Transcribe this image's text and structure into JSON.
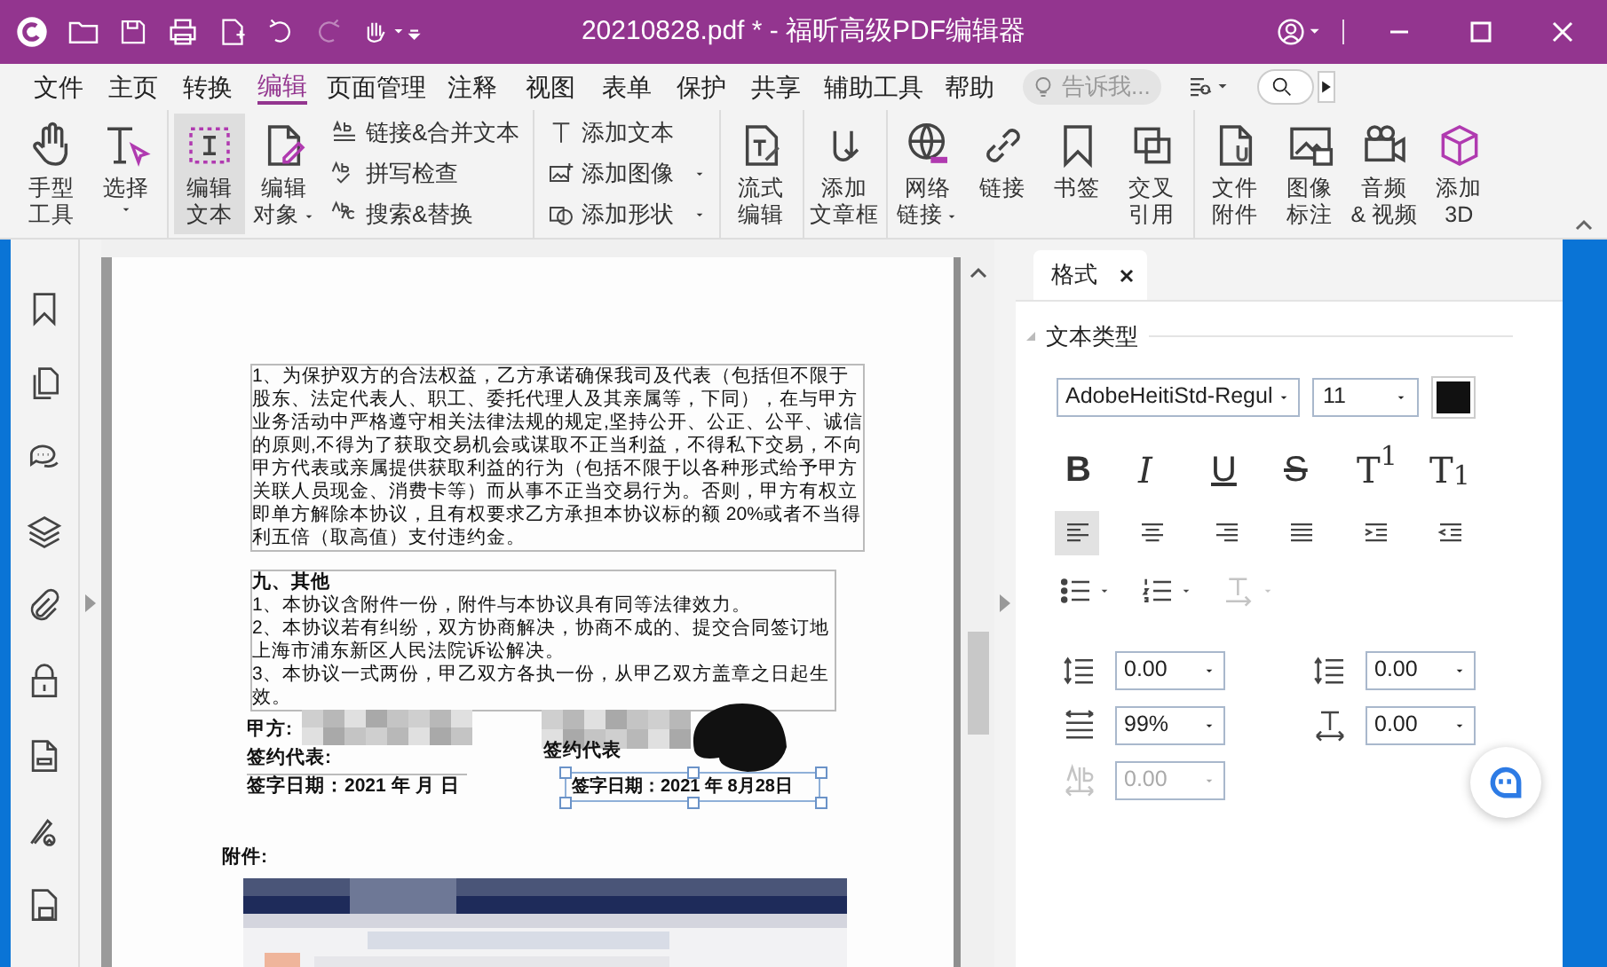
{
  "window": {
    "title": "20210828.pdf * - 福昕高级PDF编辑器"
  },
  "menu": [
    {
      "label": "文件",
      "selected": false
    },
    {
      "label": "主页",
      "selected": false
    },
    {
      "label": "转换",
      "selected": false
    },
    {
      "label": "编辑",
      "selected": true
    },
    {
      "label": "页面管理",
      "selected": false
    },
    {
      "label": "注释",
      "selected": false
    },
    {
      "label": "视图",
      "selected": false
    },
    {
      "label": "表单",
      "selected": false
    },
    {
      "label": "保护",
      "selected": false
    },
    {
      "label": "共享",
      "selected": false
    },
    {
      "label": "辅助工具",
      "selected": false
    },
    {
      "label": "帮助",
      "selected": false
    }
  ],
  "tell_me": {
    "placeholder": "告诉我..."
  },
  "ribbon": [
    {
      "items": [
        {
          "kind": "large",
          "lines": [
            "手型",
            "工具"
          ],
          "dropdown": false,
          "selected": false
        },
        {
          "kind": "large",
          "lines": [
            "选择"
          ],
          "dropdown": true,
          "selected": false
        }
      ]
    },
    {
      "items": [
        {
          "kind": "large",
          "lines": [
            "编辑",
            "文本"
          ],
          "dropdown": false,
          "selected": true
        },
        {
          "kind": "large",
          "lines": [
            "编辑",
            "对象"
          ],
          "dropdown": true,
          "selected": false
        },
        {
          "kind": "small",
          "lines": [
            "链接&合并文本"
          ],
          "dropdown": false,
          "selected": false
        },
        {
          "kind": "small",
          "lines": [
            "拼写检查"
          ],
          "dropdown": false,
          "selected": false
        },
        {
          "kind": "small",
          "lines": [
            "搜索&替换"
          ],
          "dropdown": false,
          "selected": false
        }
      ]
    },
    {
      "items": [
        {
          "kind": "small",
          "lines": [
            "添加文本"
          ],
          "dropdown": false,
          "selected": false
        },
        {
          "kind": "small",
          "lines": [
            "添加图像"
          ],
          "dropdown": true,
          "selected": false
        },
        {
          "kind": "small",
          "lines": [
            "添加形状"
          ],
          "dropdown": true,
          "selected": false
        }
      ]
    },
    {
      "items": [
        {
          "kind": "large",
          "lines": [
            "流式",
            "编辑"
          ],
          "dropdown": false,
          "selected": false
        }
      ]
    },
    {
      "items": [
        {
          "kind": "large",
          "lines": [
            "添加",
            "文章框"
          ],
          "dropdown": false,
          "selected": false
        }
      ]
    },
    {
      "items": [
        {
          "kind": "large",
          "lines": [
            "网络",
            "链接"
          ],
          "dropdown": true,
          "selected": false
        },
        {
          "kind": "large",
          "lines": [
            "链接"
          ],
          "dropdown": false,
          "selected": false
        },
        {
          "kind": "large",
          "lines": [
            "书签"
          ],
          "dropdown": false,
          "selected": false
        },
        {
          "kind": "large",
          "lines": [
            "交叉",
            "引用"
          ],
          "dropdown": false,
          "selected": false
        }
      ]
    },
    {
      "items": [
        {
          "kind": "large",
          "lines": [
            "文件",
            "附件"
          ],
          "dropdown": false,
          "selected": false
        },
        {
          "kind": "large",
          "lines": [
            "图像",
            "标注"
          ],
          "dropdown": false,
          "selected": false
        },
        {
          "kind": "large",
          "lines": [
            "音频",
            "& 视频"
          ],
          "dropdown": false,
          "selected": false
        },
        {
          "kind": "large",
          "lines": [
            "添加",
            "3D"
          ],
          "dropdown": false,
          "selected": false
        }
      ]
    }
  ],
  "document": {
    "clause": "1、为保护双方的合法权益，乙方承诺确保我司及代表（包括但不限于股东、法定代表人、职工、委托代理人及其亲属等，下同），在与甲方业务活动中严格遵守相关法律法规的规定,坚持公开、公正、公平、诚信的原则,不得为了获取交易机会或谋取不正当利益，不得私下交易，不向甲方代表或亲属提供获取利益的行为（包括不限于以各种形式给予甲方关联人员现金、消费卡等）而从事不正当交易行为。否则，甲方有权立即单方解除本协议，且有权要求乙方承担本协议标的额 20%或者不当得利五倍（取高值）支付违约金。",
    "section_title": "九、其他",
    "section_lines": [
      "1、本协议含附件一份，附件与本协议具有同等法律效力。",
      "2、本协议若有纠纷，双方协商解决，协商不成的、提交合同签订地上海市浦东新区人民法院诉讼解决。",
      "3、本协议一式两份，甲乙双方各执一份，从甲乙双方盖章之日起生效。"
    ],
    "party_a": "甲方:",
    "signer_left": "签约代表:",
    "date_left": "签字日期：2021 年    月    日",
    "signer_right": "签约代表",
    "date_right": "签字日期：2021 年 8月28日",
    "attachment_label": "附件:"
  },
  "format_panel": {
    "tab": {
      "label": "格式",
      "selected": true
    },
    "section": "文本类型",
    "font": "AdobeHeitiStd-Regul",
    "size": "11",
    "color": "#111111",
    "styles": [
      {
        "glyph": "B",
        "kind": "bold"
      },
      {
        "glyph": "I",
        "kind": "italic"
      },
      {
        "glyph": "U",
        "kind": "underline"
      },
      {
        "glyph": "S",
        "kind": "strike"
      },
      {
        "glyph": "T$^{1}$",
        "kind": "super"
      },
      {
        "glyph": "T$_{1}$",
        "kind": "sub"
      }
    ],
    "align": [
      {
        "selected": true
      },
      {
        "selected": false
      },
      {
        "selected": false
      },
      {
        "selected": false
      },
      {
        "selected": false
      },
      {
        "selected": false
      }
    ],
    "lists": [
      {
        "disabled": false
      },
      {
        "disabled": false
      },
      {
        "disabled": true
      }
    ],
    "spacing": [
      {
        "value": "0.00",
        "disabled": false
      },
      {
        "value": "0.00",
        "disabled": false
      },
      {
        "value": "99%",
        "disabled": false
      },
      {
        "value": "0.00",
        "disabled": false
      },
      {
        "value": "0.00",
        "disabled": true
      }
    ]
  }
}
